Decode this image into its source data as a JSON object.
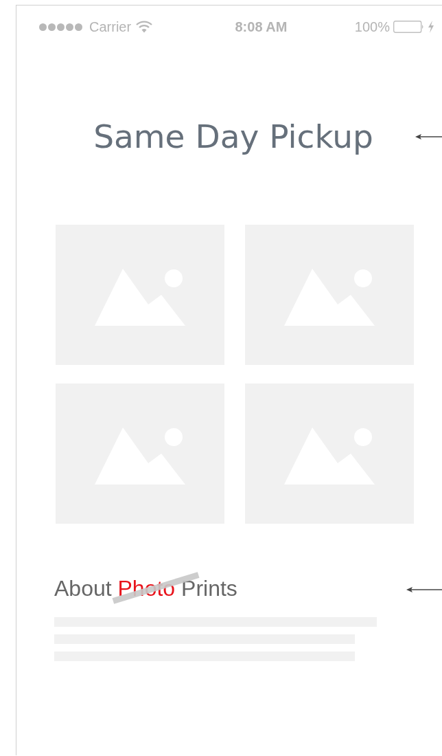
{
  "status_bar": {
    "carrier": "Carrier",
    "time": "8:08 AM",
    "battery": "100%",
    "charging": true
  },
  "title": {
    "text": "Same Day Pickup",
    "pointer": true
  },
  "section": {
    "pointer": true,
    "strike": true,
    "parts": [
      {
        "text": "About",
        "highlighted": false
      },
      {
        "text": "Photo",
        "highlighted": true
      },
      {
        "text": "Prints",
        "highlighted": false
      }
    ]
  },
  "text_lines": [
    {
      "kind": "long"
    },
    {
      "kind": "short"
    },
    {
      "kind": "short"
    }
  ]
}
